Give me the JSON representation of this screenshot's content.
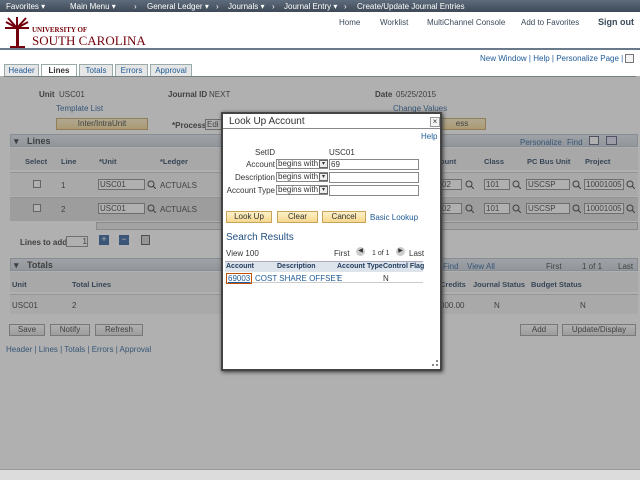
{
  "topnav": {
    "favorites": "Favorites ▾",
    "main_menu": "Main Menu ▾",
    "sep1": "›",
    "general_ledger": "General Ledger ▾",
    "sep2": "›",
    "journals": "Journals ▾",
    "sep3": "›",
    "journal_entry": "Journal Entry ▾",
    "sep4": "›",
    "create_update": "Create/Update Journal Entries"
  },
  "brand": {
    "university_of": "UNIVERSITY OF",
    "south_carolina": "SOUTH CAROLINA",
    "links": [
      "Home",
      "Worklist",
      "MultiChannel Console",
      "Add to Favorites"
    ],
    "sign_out": "Sign out"
  },
  "right_links": {
    "new_window": "New Window",
    "sep1": " | ",
    "help": "Help",
    "sep2": " | ",
    "personalize_page": "Personalize Page",
    "sep3": " | "
  },
  "tabs": [
    "Header",
    "Lines",
    "Totals",
    "Errors",
    "Approval"
  ],
  "header_fields": {
    "unit_label": "Unit",
    "unit_value": "USC01",
    "journal_id_label": "Journal ID",
    "journal_id_value": "NEXT",
    "date_label": "Date",
    "date_value": "05/25/2015",
    "template_list": "Template List",
    "change_values": "Change Values",
    "inter_intra_button": "Inter/IntraUnit",
    "process_label": "*Process",
    "process_value": "Edi",
    "process_button": "ess"
  },
  "lines_grid": {
    "title": "Lines",
    "personalize": "Personalize",
    "find": "Find",
    "columns": [
      "Select",
      "Line",
      "*Unit",
      "*Ledger",
      "ount",
      "Class",
      "PC Bus Unit",
      "Project"
    ],
    "rows": [
      {
        "line": "1",
        "unit": "USC01",
        "ledger": "ACTUALS",
        "amount": "02",
        "class": "101",
        "pc_bus_unit": "USCSP",
        "project": "10001005"
      },
      {
        "line": "2",
        "unit": "USC01",
        "ledger": "ACTUALS",
        "amount": "02",
        "class": "101",
        "pc_bus_unit": "USCSP",
        "project": "10001005"
      }
    ],
    "lines_to_add_label": "Lines to add",
    "lines_to_add_value": "1"
  },
  "totals_grid": {
    "title": "Totals",
    "find": "Find",
    "view_all": "View All",
    "first": "First",
    "pager": "1 of 1",
    "last": "Last",
    "columns": [
      "Unit",
      "Total Lines",
      "Credits",
      "Journal Status",
      "Budget Status"
    ],
    "row": {
      "unit": "USC01",
      "total_lines": "2",
      "credits": "000.00",
      "journal_status": "N",
      "budget_status": "N"
    }
  },
  "bottom_buttons": {
    "save": "Save",
    "notify": "Notify",
    "refresh": "Refresh",
    "add": "Add",
    "update_display": "Update/Display"
  },
  "bottom_links": "Header | Lines | Totals | Errors | Approval",
  "modal": {
    "title": "Look Up Account",
    "close": "×",
    "help": "Help",
    "setid_label": "SetID",
    "setid_value": "USC01",
    "account_label": "Account",
    "account_op": "begins with",
    "account_value": "69",
    "description_label": "Description",
    "description_op": "begins with",
    "description_value": "",
    "account_type_label": "Account Type",
    "account_type_op": "begins with",
    "account_type_value": "",
    "look_up": "Look Up",
    "clear": "Clear",
    "cancel": "Cancel",
    "basic_lookup": "Basic Lookup",
    "search_results": "Search Results",
    "view_100": "View 100",
    "first": "First",
    "pager": "1 of 1",
    "last": "Last",
    "result_columns": [
      "Account",
      "Description",
      "Account Type",
      "Control Flag"
    ],
    "results": [
      {
        "account": "69003",
        "description": "COST SHARE OFFSET",
        "account_type": "E",
        "control_flag": "N"
      }
    ]
  },
  "colors": {
    "accent": "#73000a",
    "link": "#1f5a96",
    "button": "#f6d78f"
  }
}
